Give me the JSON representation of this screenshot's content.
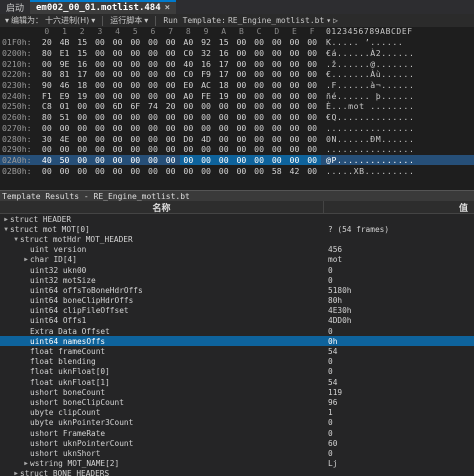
{
  "topbar": {
    "start_label": "启动",
    "file_tab": "em002_00_01.motlist.484",
    "close_glyph": "×"
  },
  "toolbar": {
    "edit_label": "编辑为：",
    "edit_mode": "十六进制(H)",
    "run_script": "运行脚本",
    "run_template_label": "Run Template:",
    "template_name": "RE_Engine_motlist.bt",
    "play_glyph": "▷"
  },
  "hex": {
    "header_bytes": [
      "0",
      "1",
      "2",
      "3",
      "4",
      "5",
      "6",
      "7",
      "8",
      "9",
      "A",
      "B",
      "C",
      "D",
      "E",
      "F"
    ],
    "header_ascii": "0123456789ABCDEF",
    "rows": [
      {
        "addr": "01F0h:",
        "bytes": [
          "20",
          "4B",
          "15",
          "00",
          "00",
          "00",
          "00",
          "00",
          "A0",
          "92",
          "15",
          "00",
          "00",
          "00",
          "00",
          "00"
        ],
        "ascii": " K..... ’......"
      },
      {
        "addr": "0200h:",
        "bytes": [
          "80",
          "E1",
          "15",
          "00",
          "00",
          "00",
          "00",
          "00",
          "C0",
          "32",
          "16",
          "00",
          "00",
          "00",
          "00",
          "00"
        ],
        "ascii": "€á......À2......"
      },
      {
        "addr": "0210h:",
        "bytes": [
          "00",
          "9E",
          "16",
          "00",
          "00",
          "00",
          "00",
          "00",
          "40",
          "16",
          "17",
          "00",
          "00",
          "00",
          "00",
          "00"
        ],
        "ascii": ".ž......@......."
      },
      {
        "addr": "0220h:",
        "bytes": [
          "80",
          "81",
          "17",
          "00",
          "00",
          "00",
          "00",
          "00",
          "C0",
          "F9",
          "17",
          "00",
          "00",
          "00",
          "00",
          "00"
        ],
        "ascii": "€.......Àù......"
      },
      {
        "addr": "0230h:",
        "bytes": [
          "90",
          "46",
          "18",
          "00",
          "00",
          "00",
          "00",
          "00",
          "E0",
          "AC",
          "18",
          "00",
          "00",
          "00",
          "00",
          "00"
        ],
        "ascii": ".F......à¬......"
      },
      {
        "addr": "0240h:",
        "bytes": [
          "F1",
          "E9",
          "19",
          "00",
          "00",
          "00",
          "00",
          "00",
          "A0",
          "FE",
          "19",
          "00",
          "00",
          "00",
          "00",
          "00"
        ],
        "ascii": "ñé...... þ......"
      },
      {
        "addr": "0250h:",
        "bytes": [
          "C8",
          "01",
          "00",
          "00",
          "6D",
          "6F",
          "74",
          "20",
          "00",
          "00",
          "00",
          "00",
          "00",
          "00",
          "00",
          "00"
        ],
        "ascii": "È...mot ........"
      },
      {
        "addr": "0260h:",
        "bytes": [
          "80",
          "51",
          "00",
          "00",
          "00",
          "00",
          "00",
          "00",
          "00",
          "00",
          "00",
          "00",
          "00",
          "00",
          "00",
          "00"
        ],
        "ascii": "€Q.............."
      },
      {
        "addr": "0270h:",
        "bytes": [
          "00",
          "00",
          "00",
          "00",
          "00",
          "00",
          "00",
          "00",
          "00",
          "00",
          "00",
          "00",
          "00",
          "00",
          "00",
          "00"
        ],
        "ascii": "................"
      },
      {
        "addr": "0280h:",
        "bytes": [
          "30",
          "4E",
          "00",
          "00",
          "00",
          "00",
          "00",
          "00",
          "D0",
          "4D",
          "00",
          "00",
          "00",
          "00",
          "00",
          "00"
        ],
        "ascii": "0N......ÐM......"
      },
      {
        "addr": "0290h:",
        "bytes": [
          "00",
          "00",
          "00",
          "00",
          "00",
          "00",
          "00",
          "00",
          "00",
          "00",
          "00",
          "00",
          "00",
          "00",
          "00",
          "00"
        ],
        "ascii": "................"
      },
      {
        "addr": "02A0h:",
        "bytes": [
          "40",
          "50",
          "00",
          "00",
          "00",
          "00",
          "00",
          "00",
          "00",
          "00",
          "00",
          "00",
          "00",
          "00",
          "00",
          "00"
        ],
        "ascii": "@P.............."
      },
      {
        "addr": "02B0h:",
        "bytes": [
          "00",
          "00",
          "00",
          "00",
          "00",
          "00",
          "00",
          "00",
          "00",
          "00",
          "00",
          "00",
          "00",
          "58",
          "42",
          "00"
        ],
        "ascii": ".....XB........."
      }
    ]
  },
  "results": {
    "title": "Template Results - RE_Engine_motlist.bt",
    "col_name": "名称",
    "col_value": "值",
    "rows": [
      {
        "indent": 0,
        "twisty": ">",
        "name": "struct HEADER",
        "value": ""
      },
      {
        "indent": 0,
        "twisty": "v",
        "name": "struct mot MOT[0]",
        "value": "? (54 frames)"
      },
      {
        "indent": 1,
        "twisty": "v",
        "name": "struct motHdr MOT_HEADER",
        "value": ""
      },
      {
        "indent": 2,
        "twisty": "",
        "name": "uint version",
        "value": "456"
      },
      {
        "indent": 2,
        "twisty": ">",
        "name": "char ID[4]",
        "value": "mot"
      },
      {
        "indent": 2,
        "twisty": "",
        "name": "uint32 ukn00",
        "value": "0"
      },
      {
        "indent": 2,
        "twisty": "",
        "name": "uint32 motSize",
        "value": "0"
      },
      {
        "indent": 2,
        "twisty": "",
        "name": "uint64 offsToBoneHdrOffs",
        "value": "5180h"
      },
      {
        "indent": 2,
        "twisty": "",
        "name": "uint64 boneClipHdrOffs",
        "value": "80h"
      },
      {
        "indent": 2,
        "twisty": "",
        "name": "uint64 clipFileOffset",
        "value": "4E30h"
      },
      {
        "indent": 2,
        "twisty": "",
        "name": "uint64 Offs1",
        "value": "4DD0h"
      },
      {
        "indent": 2,
        "twisty": "",
        "name": "Extra Data Offset",
        "value": "0"
      },
      {
        "indent": 2,
        "twisty": "",
        "name": "uint64 namesOffs",
        "value": "0h",
        "selected": true
      },
      {
        "indent": 2,
        "twisty": "",
        "name": "float frameCount",
        "value": "54"
      },
      {
        "indent": 2,
        "twisty": "",
        "name": "float blending",
        "value": "0"
      },
      {
        "indent": 2,
        "twisty": "",
        "name": "float uknFloat[0]",
        "value": "0"
      },
      {
        "indent": 2,
        "twisty": "",
        "name": "float uknFloat[1]",
        "value": "54"
      },
      {
        "indent": 2,
        "twisty": "",
        "name": "ushort boneCount",
        "value": "119"
      },
      {
        "indent": 2,
        "twisty": "",
        "name": "ushort boneClipCount",
        "value": "96"
      },
      {
        "indent": 2,
        "twisty": "",
        "name": "ubyte clipCount",
        "value": "1"
      },
      {
        "indent": 2,
        "twisty": "",
        "name": "ubyte uknPointer3Count",
        "value": "0"
      },
      {
        "indent": 2,
        "twisty": "",
        "name": "ushort FrameRate",
        "value": "0"
      },
      {
        "indent": 2,
        "twisty": "",
        "name": "ushort uknPointerCount",
        "value": "60"
      },
      {
        "indent": 2,
        "twisty": "",
        "name": "ushort uknShort",
        "value": "0"
      },
      {
        "indent": 2,
        "twisty": ">",
        "name": "wstring MOT_NAME[2]",
        "value": "Lj"
      },
      {
        "indent": 1,
        "twisty": ">",
        "name": "struct BONE_HEADERS",
        "value": ""
      }
    ]
  },
  "colors": {
    "accent": "#007acc",
    "selection": "#0e639c",
    "highlight_row": "#264f78"
  }
}
